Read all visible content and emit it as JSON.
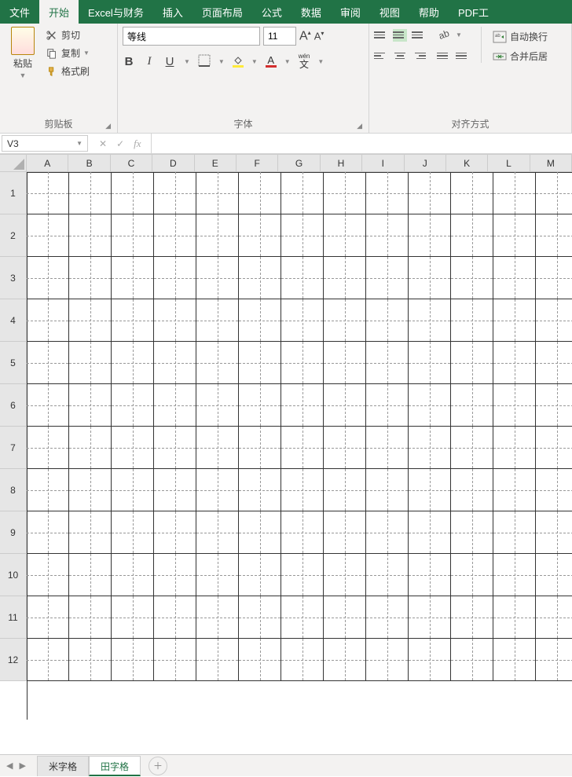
{
  "tabs": {
    "file": "文件",
    "home": "开始",
    "excel_finance": "Excel与财务",
    "insert": "插入",
    "page_layout": "页面布局",
    "formulas": "公式",
    "data": "数据",
    "review": "审阅",
    "view": "视图",
    "help": "帮助",
    "pdf": "PDF工"
  },
  "clipboard": {
    "paste": "粘贴",
    "cut": "剪切",
    "copy": "复制",
    "format_painter": "格式刷",
    "group_title": "剪贴板"
  },
  "font": {
    "name": "等线",
    "size": "11",
    "group_title": "字体",
    "pinyin": "wén"
  },
  "align": {
    "wrap": "自动换行",
    "merge": "合并后居",
    "group_title": "对齐方式"
  },
  "namebox": "V3",
  "columns": [
    "A",
    "B",
    "C",
    "D",
    "E",
    "F",
    "G",
    "H",
    "I",
    "J",
    "K",
    "L",
    "M"
  ],
  "rows": [
    "1",
    "2",
    "3",
    "4",
    "5",
    "6",
    "7",
    "8",
    "9",
    "10",
    "11",
    "12"
  ],
  "sheets": {
    "s1": "米字格",
    "s2": "田字格"
  }
}
